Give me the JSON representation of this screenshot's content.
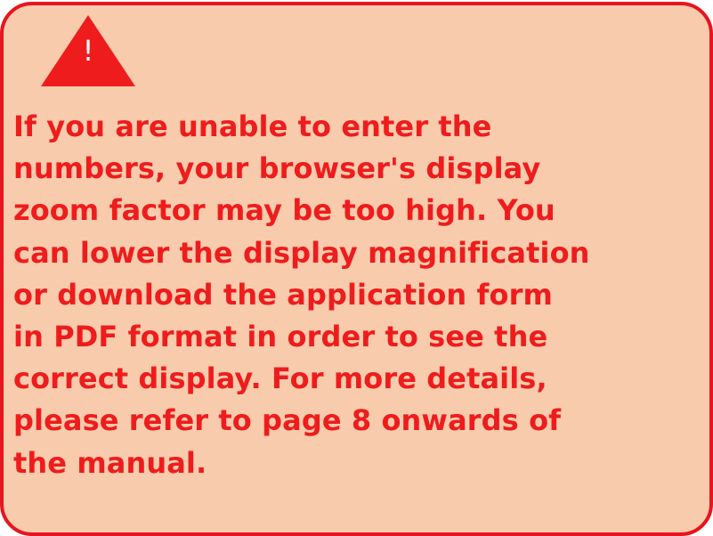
{
  "colors": {
    "background": "#f8cbad",
    "border": "#e8141e",
    "text": "#ee1c1c",
    "icon_fill": "#ee1c1c",
    "icon_glyph": "#ffffff"
  },
  "warning": {
    "icon": "warning-triangle-icon",
    "glyph": "!"
  },
  "message": {
    "lines": [
      "If you are unable to enter the",
      "numbers, your browser's display",
      "zoom factor may be too high. You",
      "can lower the display magnification",
      "or download the application form",
      "in PDF format in order to see the",
      "correct display. For more details,",
      "please refer to page 8 onwards of",
      "the manual."
    ]
  }
}
